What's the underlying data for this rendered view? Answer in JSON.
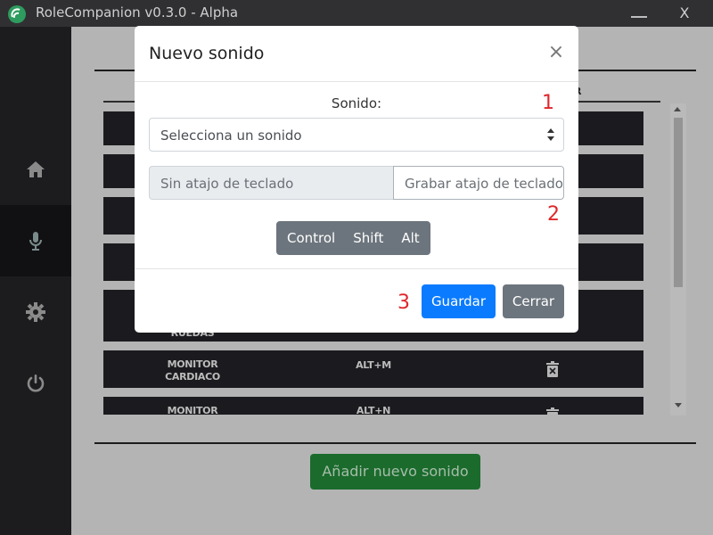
{
  "window": {
    "title": "RoleCompanion v0.3.0 - Alpha",
    "close_glyph": "X"
  },
  "sidebar": {
    "items": [
      {
        "icon": "home-icon",
        "active": false
      },
      {
        "icon": "microphone-icon",
        "active": true
      },
      {
        "icon": "gear-icon",
        "active": false
      },
      {
        "icon": "power-icon",
        "active": false
      }
    ]
  },
  "table": {
    "header_partial": "R",
    "rows": [
      {
        "name": "",
        "key": ""
      },
      {
        "name": "",
        "key": ""
      },
      {
        "name": "",
        "key": ""
      },
      {
        "name": "",
        "key": ""
      },
      {
        "name": "RUEDAS",
        "key": ""
      },
      {
        "name": "MONITOR\nCARDIACO",
        "key": "ALT+M"
      },
      {
        "name": "MONITOR",
        "key": "ALT+N"
      }
    ]
  },
  "add_button_label": "Añadir nuevo sonido",
  "modal": {
    "title": "Nuevo sonido",
    "close_glyph": "×",
    "sound_label": "Sonido:",
    "sound_select_value": "Selecciona un sonido",
    "no_shortcut_text": "Sin atajo de teclado",
    "record_shortcut_placeholder": "Grabar atajo de teclado",
    "modifiers": [
      "Control",
      "Shift",
      "Alt"
    ],
    "save_label": "Guardar",
    "close_label": "Cerrar"
  },
  "annotations": [
    "1",
    "2",
    "3"
  ],
  "colors": {
    "save_button": "#0a7bff",
    "secondary_button": "#6c757d",
    "add_button": "#1f7a33",
    "annotation": "#e0262b",
    "sidebar": "#1c1c1f"
  }
}
